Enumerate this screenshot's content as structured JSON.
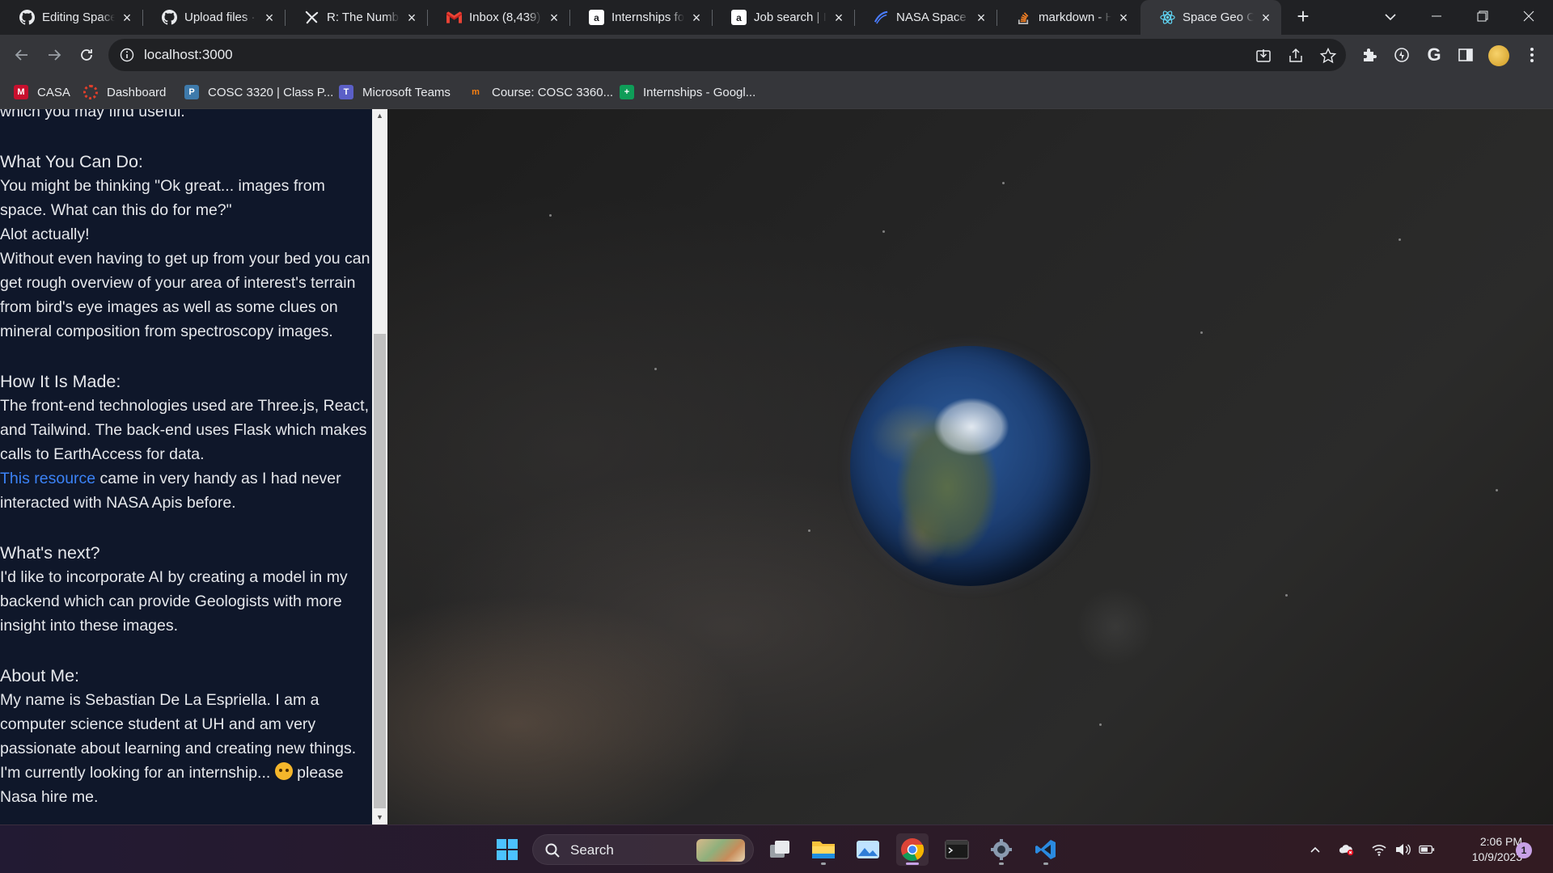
{
  "browser": {
    "tabs": [
      {
        "title": "Editing Space Geo Cube",
        "icon": "github-icon"
      },
      {
        "title": "Upload files · Space Geo Cube",
        "icon": "github-icon"
      },
      {
        "title": "R: The Number",
        "icon": "r-project-icon"
      },
      {
        "title": "Inbox (8,439)",
        "icon": "gmail-icon"
      },
      {
        "title": "Internships for",
        "icon": "indeed-icon"
      },
      {
        "title": "Job search | Indeed",
        "icon": "indeed-icon"
      },
      {
        "title": "NASA Space Apps",
        "icon": "nasa-icon"
      },
      {
        "title": "markdown - How",
        "icon": "stackoverflow-icon"
      },
      {
        "title": "Space Geo Cube",
        "icon": "react-icon",
        "active": true
      }
    ],
    "address": "localhost:3000",
    "bookmarks": [
      {
        "label": "CASA",
        "icon": "casa-icon"
      },
      {
        "label": "Dashboard",
        "icon": "dashboard-icon"
      },
      {
        "label": "COSC 3320 | Class P...",
        "icon": "piazza-icon"
      },
      {
        "label": "Microsoft Teams",
        "icon": "teams-icon"
      },
      {
        "label": "Course: COSC 3360...",
        "icon": "moodle-icon"
      },
      {
        "label": "Internships - Googl...",
        "icon": "sheets-icon"
      }
    ]
  },
  "sidebar": {
    "intro_tail": "which you may find useful.",
    "sections": {
      "what": {
        "heading": "What You Can Do:",
        "p1": "You might be thinking \"Ok great... images from space. What can this do for me?\"",
        "p2": "Alot actually!",
        "p3": "Without even having to get up from your bed you can get rough overview of your area of interest's terrain from bird's eye images as well as some clues on mineral composition from spectroscopy images."
      },
      "how": {
        "heading": "How It Is Made:",
        "p1": "The front-end technologies used are Three.js, React, and Tailwind. The back-end uses Flask which makes calls to EarthAccess for data.",
        "link_text": "This resource",
        "p2_rest": " came in very handy as I had never interacted with NASA Apis before."
      },
      "next": {
        "heading": "What's next?",
        "p1": "I'd like to incorporate AI by creating a model in my backend which can provide Geologists with more insight into these images."
      },
      "about": {
        "heading": "About Me:",
        "p1": "My name is Sebastian De La Espriella. I am a computer science student at UH and am very passionate about learning and creating new things. I'm currently looking for an internship... ",
        "p1_end": " please Nasa hire me."
      }
    }
  },
  "taskbar": {
    "search_label": "Search",
    "time": "2:06 PM",
    "date": "10/9/2023",
    "notification_count": "1",
    "apps": [
      "start-icon",
      "task-view-icon",
      "file-explorer-icon",
      "photos-icon",
      "chrome-icon",
      "terminal-icon",
      "settings-icon",
      "vscode-icon"
    ]
  }
}
